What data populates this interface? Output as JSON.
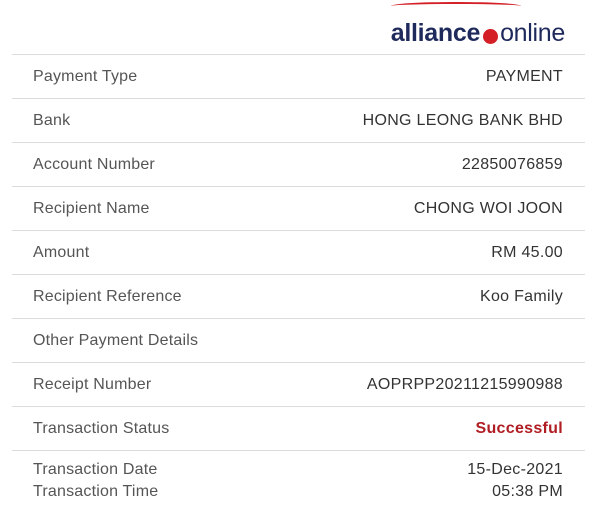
{
  "brand": {
    "word1": "alliance",
    "word2": "online",
    "accent": "#d41f26",
    "navy": "#1f2a5c"
  },
  "rows": [
    {
      "label": "Payment Type",
      "value": "PAYMENT"
    },
    {
      "label": "Bank",
      "value": "HONG LEONG BANK BHD"
    },
    {
      "label": "Account Number",
      "value": "22850076859"
    },
    {
      "label": "Recipient Name",
      "value": "CHONG WOI JOON"
    },
    {
      "label": "Amount",
      "value": "RM 45.00"
    },
    {
      "label": "Recipient Reference",
      "value": "Koo Family"
    },
    {
      "label": "Other Payment Details",
      "value": ""
    },
    {
      "label": "Receipt Number",
      "value": "AOPRPP20211215990988"
    },
    {
      "label": "Transaction Status",
      "value": "Successful"
    }
  ],
  "datetime": {
    "date_label": "Transaction Date",
    "time_label": "Transaction Time",
    "date_value": "15-Dec-2021",
    "time_value": "05:38 PM"
  },
  "colors": {
    "success": "#b01d23",
    "divider": "#dcdcdc"
  }
}
